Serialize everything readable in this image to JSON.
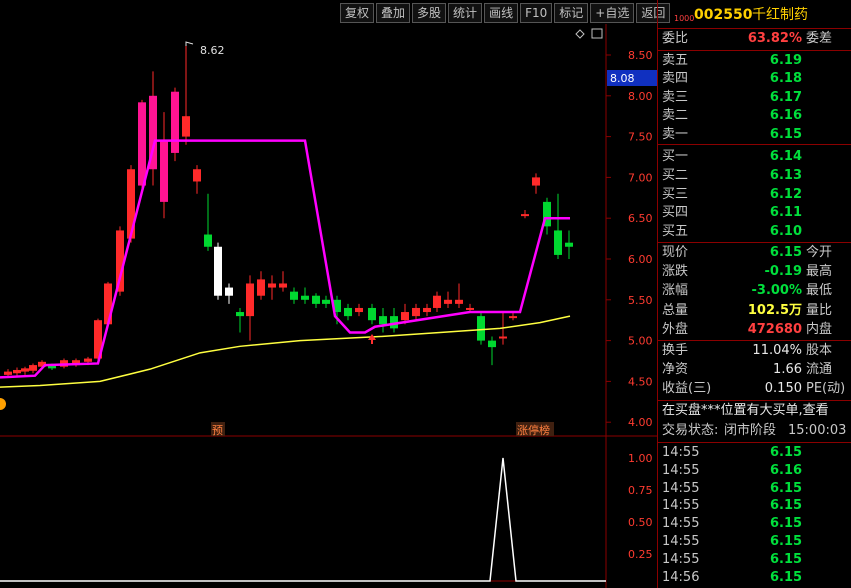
{
  "toolbar": [
    "复权",
    "叠加",
    "多股",
    "统计",
    "画线",
    "F10",
    "标记",
    "+自选",
    "返回"
  ],
  "stock": {
    "code": "002550",
    "name": "千红制药",
    "badge": "1000"
  },
  "chart": {
    "y_labels": [
      "8.50",
      "8.00",
      "7.50",
      "7.00",
      "6.50",
      "6.00",
      "5.50",
      "5.00",
      "4.50",
      "4.00"
    ],
    "high_label": "8.62",
    "price_box": "8.08",
    "marker_pre": "预",
    "marker_zt": "涨停榜",
    "vol_labels": [
      "1.00",
      "0.75",
      "0.50",
      "0.25"
    ]
  },
  "colors": {
    "up": "#ff2a2a",
    "down": "#00d830",
    "magenta": "#ff00ff",
    "yellow": "#ffff40",
    "bg": "#000000"
  },
  "weibi": {
    "label": "委比",
    "value": "63.82%",
    "label2": "委差"
  },
  "asks": [
    {
      "label": "卖五",
      "price": "6.19"
    },
    {
      "label": "卖四",
      "price": "6.18"
    },
    {
      "label": "卖三",
      "price": "6.17"
    },
    {
      "label": "卖二",
      "price": "6.16"
    },
    {
      "label": "卖一",
      "price": "6.15"
    }
  ],
  "bids": [
    {
      "label": "买一",
      "price": "6.14"
    },
    {
      "label": "买二",
      "price": "6.13"
    },
    {
      "label": "买三",
      "price": "6.12"
    },
    {
      "label": "买四",
      "price": "6.11"
    },
    {
      "label": "买五",
      "price": "6.10"
    }
  ],
  "quote": [
    {
      "label": "现价",
      "value": "6.15",
      "label2": "今开",
      "color": "green"
    },
    {
      "label": "涨跌",
      "value": "-0.19",
      "label2": "最高",
      "color": "green"
    },
    {
      "label": "涨幅",
      "value": "-3.00%",
      "label2": "最低",
      "color": "green"
    },
    {
      "label": "总量",
      "value": "102.5万",
      "label2": "量比",
      "color": "yellow"
    },
    {
      "label": "外盘",
      "value": "472680",
      "label2": "内盘",
      "color": "red"
    }
  ],
  "stats": [
    {
      "label": "换手",
      "value": "11.04%",
      "label2": "股本"
    },
    {
      "label": "净资",
      "value": "1.66",
      "label2": "流通"
    },
    {
      "label": "收益(三)",
      "value": "0.150",
      "label2": "PE(动)"
    }
  ],
  "notice": "在买盘***位置有大买单,查看",
  "status": {
    "label": "交易状态:",
    "value": "闭市阶段",
    "time": "15:00:03"
  },
  "ticks": [
    {
      "time": "14:55",
      "price": "6.15"
    },
    {
      "time": "14:55",
      "price": "6.16"
    },
    {
      "time": "14:55",
      "price": "6.15"
    },
    {
      "time": "14:55",
      "price": "6.15"
    },
    {
      "time": "14:55",
      "price": "6.15"
    },
    {
      "time": "14:55",
      "price": "6.15"
    },
    {
      "time": "14:55",
      "price": "6.15"
    },
    {
      "time": "14:56",
      "price": "6.15"
    }
  ]
}
